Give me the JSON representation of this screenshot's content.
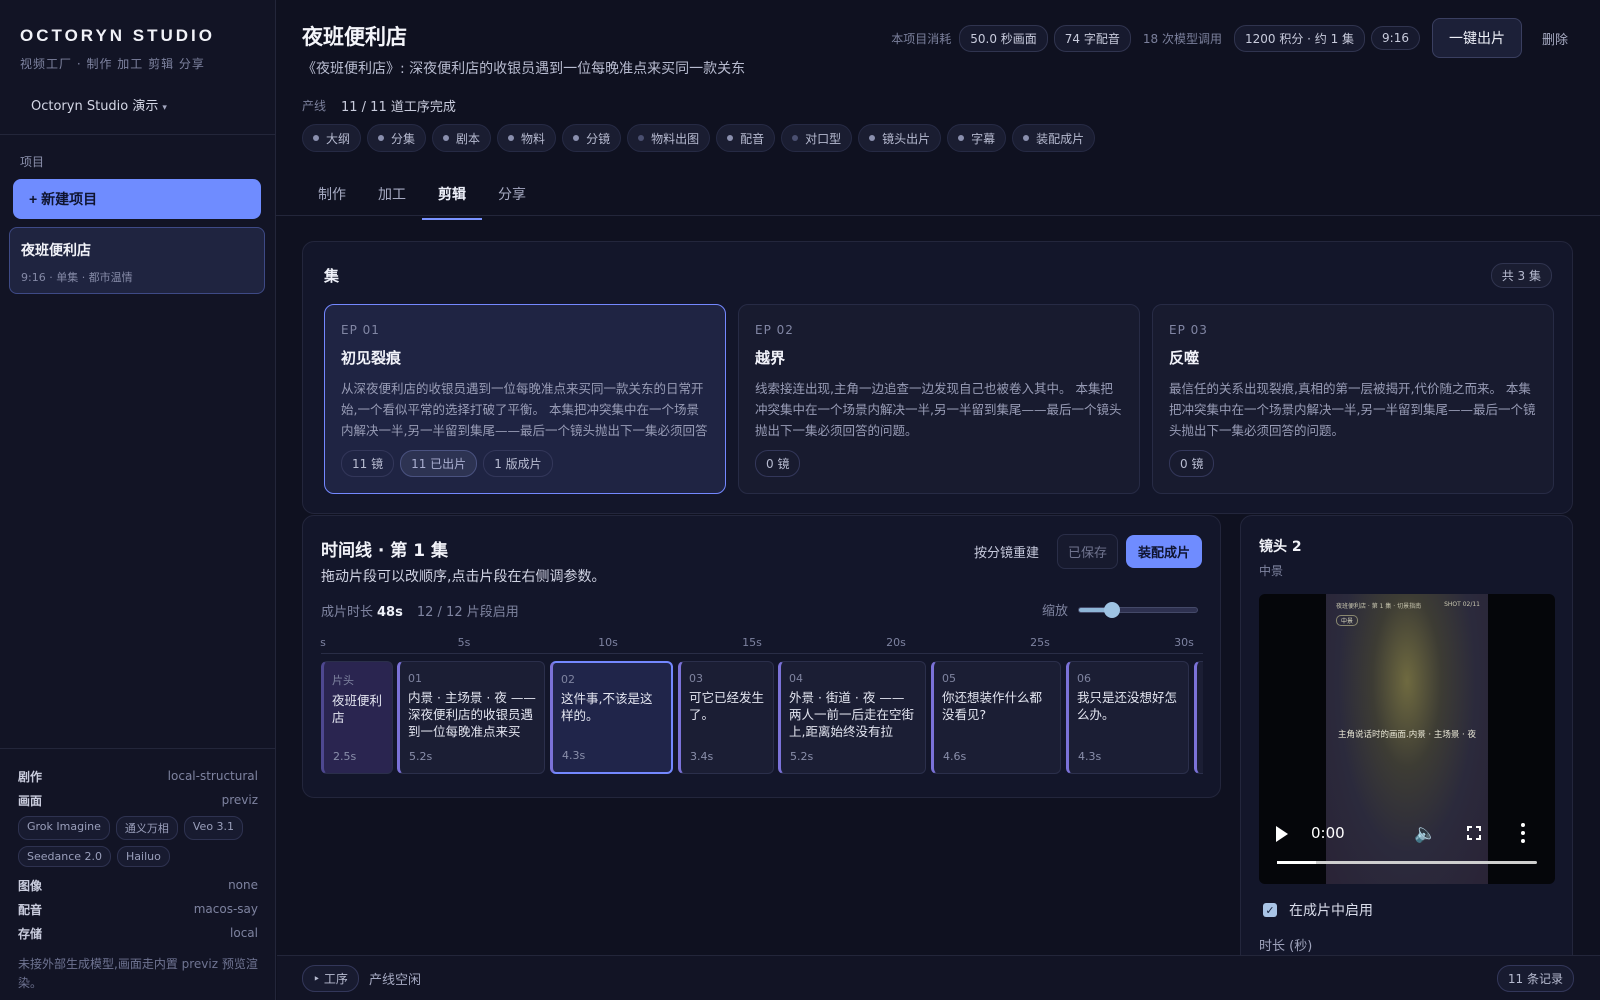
{
  "sidebar": {
    "brand": "OCTORYN STUDIO",
    "brand_sub": "视频工厂 · 制作 加工 剪辑 分享",
    "workspace": "Octoryn Studio 演示",
    "projects_label": "项目",
    "new_project": "+ 新建项目",
    "project": {
      "title": "夜班便利店",
      "meta": "9:16 · 单集 · 都市温情"
    },
    "env": {
      "script": {
        "k": "剧作",
        "v": "local-structural"
      },
      "visual": {
        "k": "画面",
        "v": "previz"
      },
      "models": [
        "Grok Imagine",
        "通义万相",
        "Veo 3.1",
        "Seedance 2.0",
        "Hailuo"
      ],
      "image": {
        "k": "图像",
        "v": "none"
      },
      "voice": {
        "k": "配音",
        "v": "macos-say"
      },
      "storage": {
        "k": "存储",
        "v": "local"
      },
      "note": "未接外部生成模型,画面走内置 previz 预览渲染。"
    }
  },
  "header": {
    "title": "夜班便利店",
    "logline": "《夜班便利店》: 深夜便利店的收银员遇到一位每晚准点来买同一款关东",
    "usage_label": "本项目消耗",
    "usage_seconds": "50.0 秒画面",
    "usage_voice": "74 字配音",
    "usage_calls": "18 次模型调用",
    "credits": "1200 积分 · 约 1 集",
    "ratio": "9:16",
    "export": "一键出片",
    "delete": "删除",
    "pipeline_label": "产线",
    "pipeline_status": "11 / 11 道工序完成",
    "stages": [
      "大纲",
      "分集",
      "剧本",
      "物料",
      "分镜",
      "物料出图",
      "配音",
      "对口型",
      "镜头出片",
      "字幕",
      "装配成片"
    ],
    "tabs": [
      "制作",
      "加工",
      "剪辑",
      "分享"
    ],
    "active_tab": "剪辑"
  },
  "episodes": {
    "heading": "集",
    "count": "共 3 集",
    "items": [
      {
        "num": "EP 01",
        "title": "初见裂痕",
        "desc": "从深夜便利店的收银员遇到一位每晚准点来买同一款关东的日常开始,一个看似平常的选择打破了平衡。 本集把冲突集中在一个场景内解决一半,另一半留到集尾——最后一个镜头抛出下一集必须回答的问题。",
        "tags": [
          "11 镜",
          "11 已出片",
          "1 版成片"
        ]
      },
      {
        "num": "EP 02",
        "title": "越界",
        "desc": "线索接连出现,主角一边追查一边发现自己也被卷入其中。 本集把冲突集中在一个场景内解决一半,另一半留到集尾——最后一个镜头抛出下一集必须回答的问题。",
        "tags": [
          "0 镜"
        ]
      },
      {
        "num": "EP 03",
        "title": "反噬",
        "desc": "最信任的关系出现裂痕,真相的第一层被揭开,代价随之而来。 本集把冲突集中在一个场景内解决一半,另一半留到集尾——最后一个镜头抛出下一集必须回答的问题。",
        "tags": [
          "0 镜"
        ]
      }
    ]
  },
  "timeline": {
    "title": "时间线 · 第 1 集",
    "hint": "拖动片段可以改顺序,点击片段在右侧调参数。",
    "rebuild": "按分镜重建",
    "saved": "已保存",
    "assemble": "装配成片",
    "duration_label": "成片时长",
    "duration": "48s",
    "enabled": "12 / 12 片段启用",
    "zoom_label": "缩放",
    "zoom_level": 0.28,
    "ticks": [
      "s",
      "5s",
      "10s",
      "15s",
      "20s",
      "25s",
      "30s"
    ],
    "clips": [
      {
        "n": "片头",
        "text": "夜班便利店",
        "dur": "2.5s"
      },
      {
        "n": "01",
        "text": "内景 · 主场景 · 夜 —— 深夜便利店的收银员遇到一位每晚准点来买",
        "dur": "5.2s"
      },
      {
        "n": "02",
        "text": "这件事,不该是这样的。",
        "dur": "4.3s"
      },
      {
        "n": "03",
        "text": "可它已经发生了。",
        "dur": "3.4s"
      },
      {
        "n": "04",
        "text": "外景 · 街道 · 夜 —— 两人一前一后走在空街上,距离始终没有拉近。",
        "dur": "5.2s"
      },
      {
        "n": "05",
        "text": "你还想装作什么都没看见?",
        "dur": "4.6s"
      },
      {
        "n": "06",
        "text": "我只是还没想好怎么办。",
        "dur": "4.3s"
      }
    ]
  },
  "shot": {
    "title": "镜头 2",
    "framing": "中景",
    "frame_top": "夜班便利店 · 第 1 集 · 切景指南",
    "frame_id": "SHOT 02/11",
    "frame_badge": "中景",
    "frame_caption": "主角说话时的画面.内景 · 主场景 · 夜",
    "time": "0:00",
    "progress": 0.15,
    "enable_label": "在成片中启用",
    "duration_label": "时长 (秒)"
  },
  "footer": {
    "steps": "‣ 工序",
    "status": "产线空闲",
    "records": "11 条记录"
  },
  "colors": {
    "accent": "#6f8cff",
    "bg": "#0f1120",
    "panel": "#13162a"
  }
}
